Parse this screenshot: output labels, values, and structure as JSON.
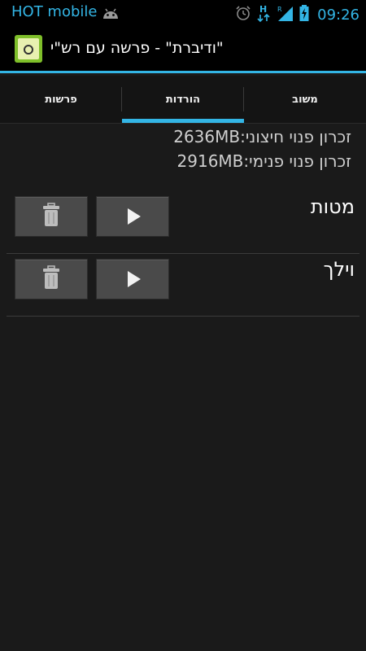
{
  "status_bar": {
    "carrier": "HOT mobile",
    "time": "09:26"
  },
  "action_bar": {
    "title": "\"ודיברת\" - פרשה עם רש\"י"
  },
  "tabs": [
    {
      "label": "פרשות",
      "active": false
    },
    {
      "label": "הורדות",
      "active": true
    },
    {
      "label": "משוב",
      "active": false
    }
  ],
  "memory": {
    "external": "זכרון פנוי חיצוני:2636MB",
    "internal": "זכרון פנוי פנימי:2916MB"
  },
  "downloads": [
    {
      "title": "מטות"
    },
    {
      "title": "וילך"
    }
  ],
  "colors": {
    "accent": "#33b5e5",
    "background": "#1a1a1a",
    "button": "#4a4a4a"
  }
}
